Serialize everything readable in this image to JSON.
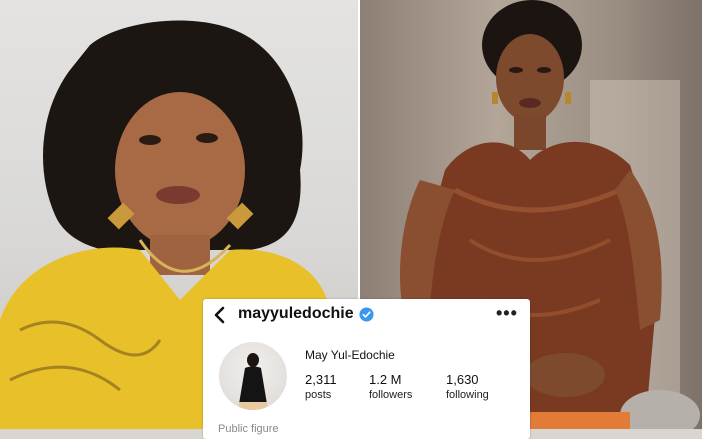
{
  "profile": {
    "username": "mayyuledochie",
    "display_name": "May Yul-Edochie",
    "category": "Public figure",
    "stats": [
      {
        "value": "2,311",
        "label": "posts"
      },
      {
        "value": "1.2 M",
        "label": "followers"
      },
      {
        "value": "1,630",
        "label": "following"
      }
    ]
  },
  "icons": {
    "back": "chevron-left-icon",
    "verified": "verified-badge-icon",
    "more": "more-options-icon"
  },
  "colors": {
    "verified_blue": "#3897f0",
    "left_dress_yellow": "#e8c12a",
    "right_dress_brown": "#7a3a22",
    "accent_orange": "#e27a38"
  }
}
